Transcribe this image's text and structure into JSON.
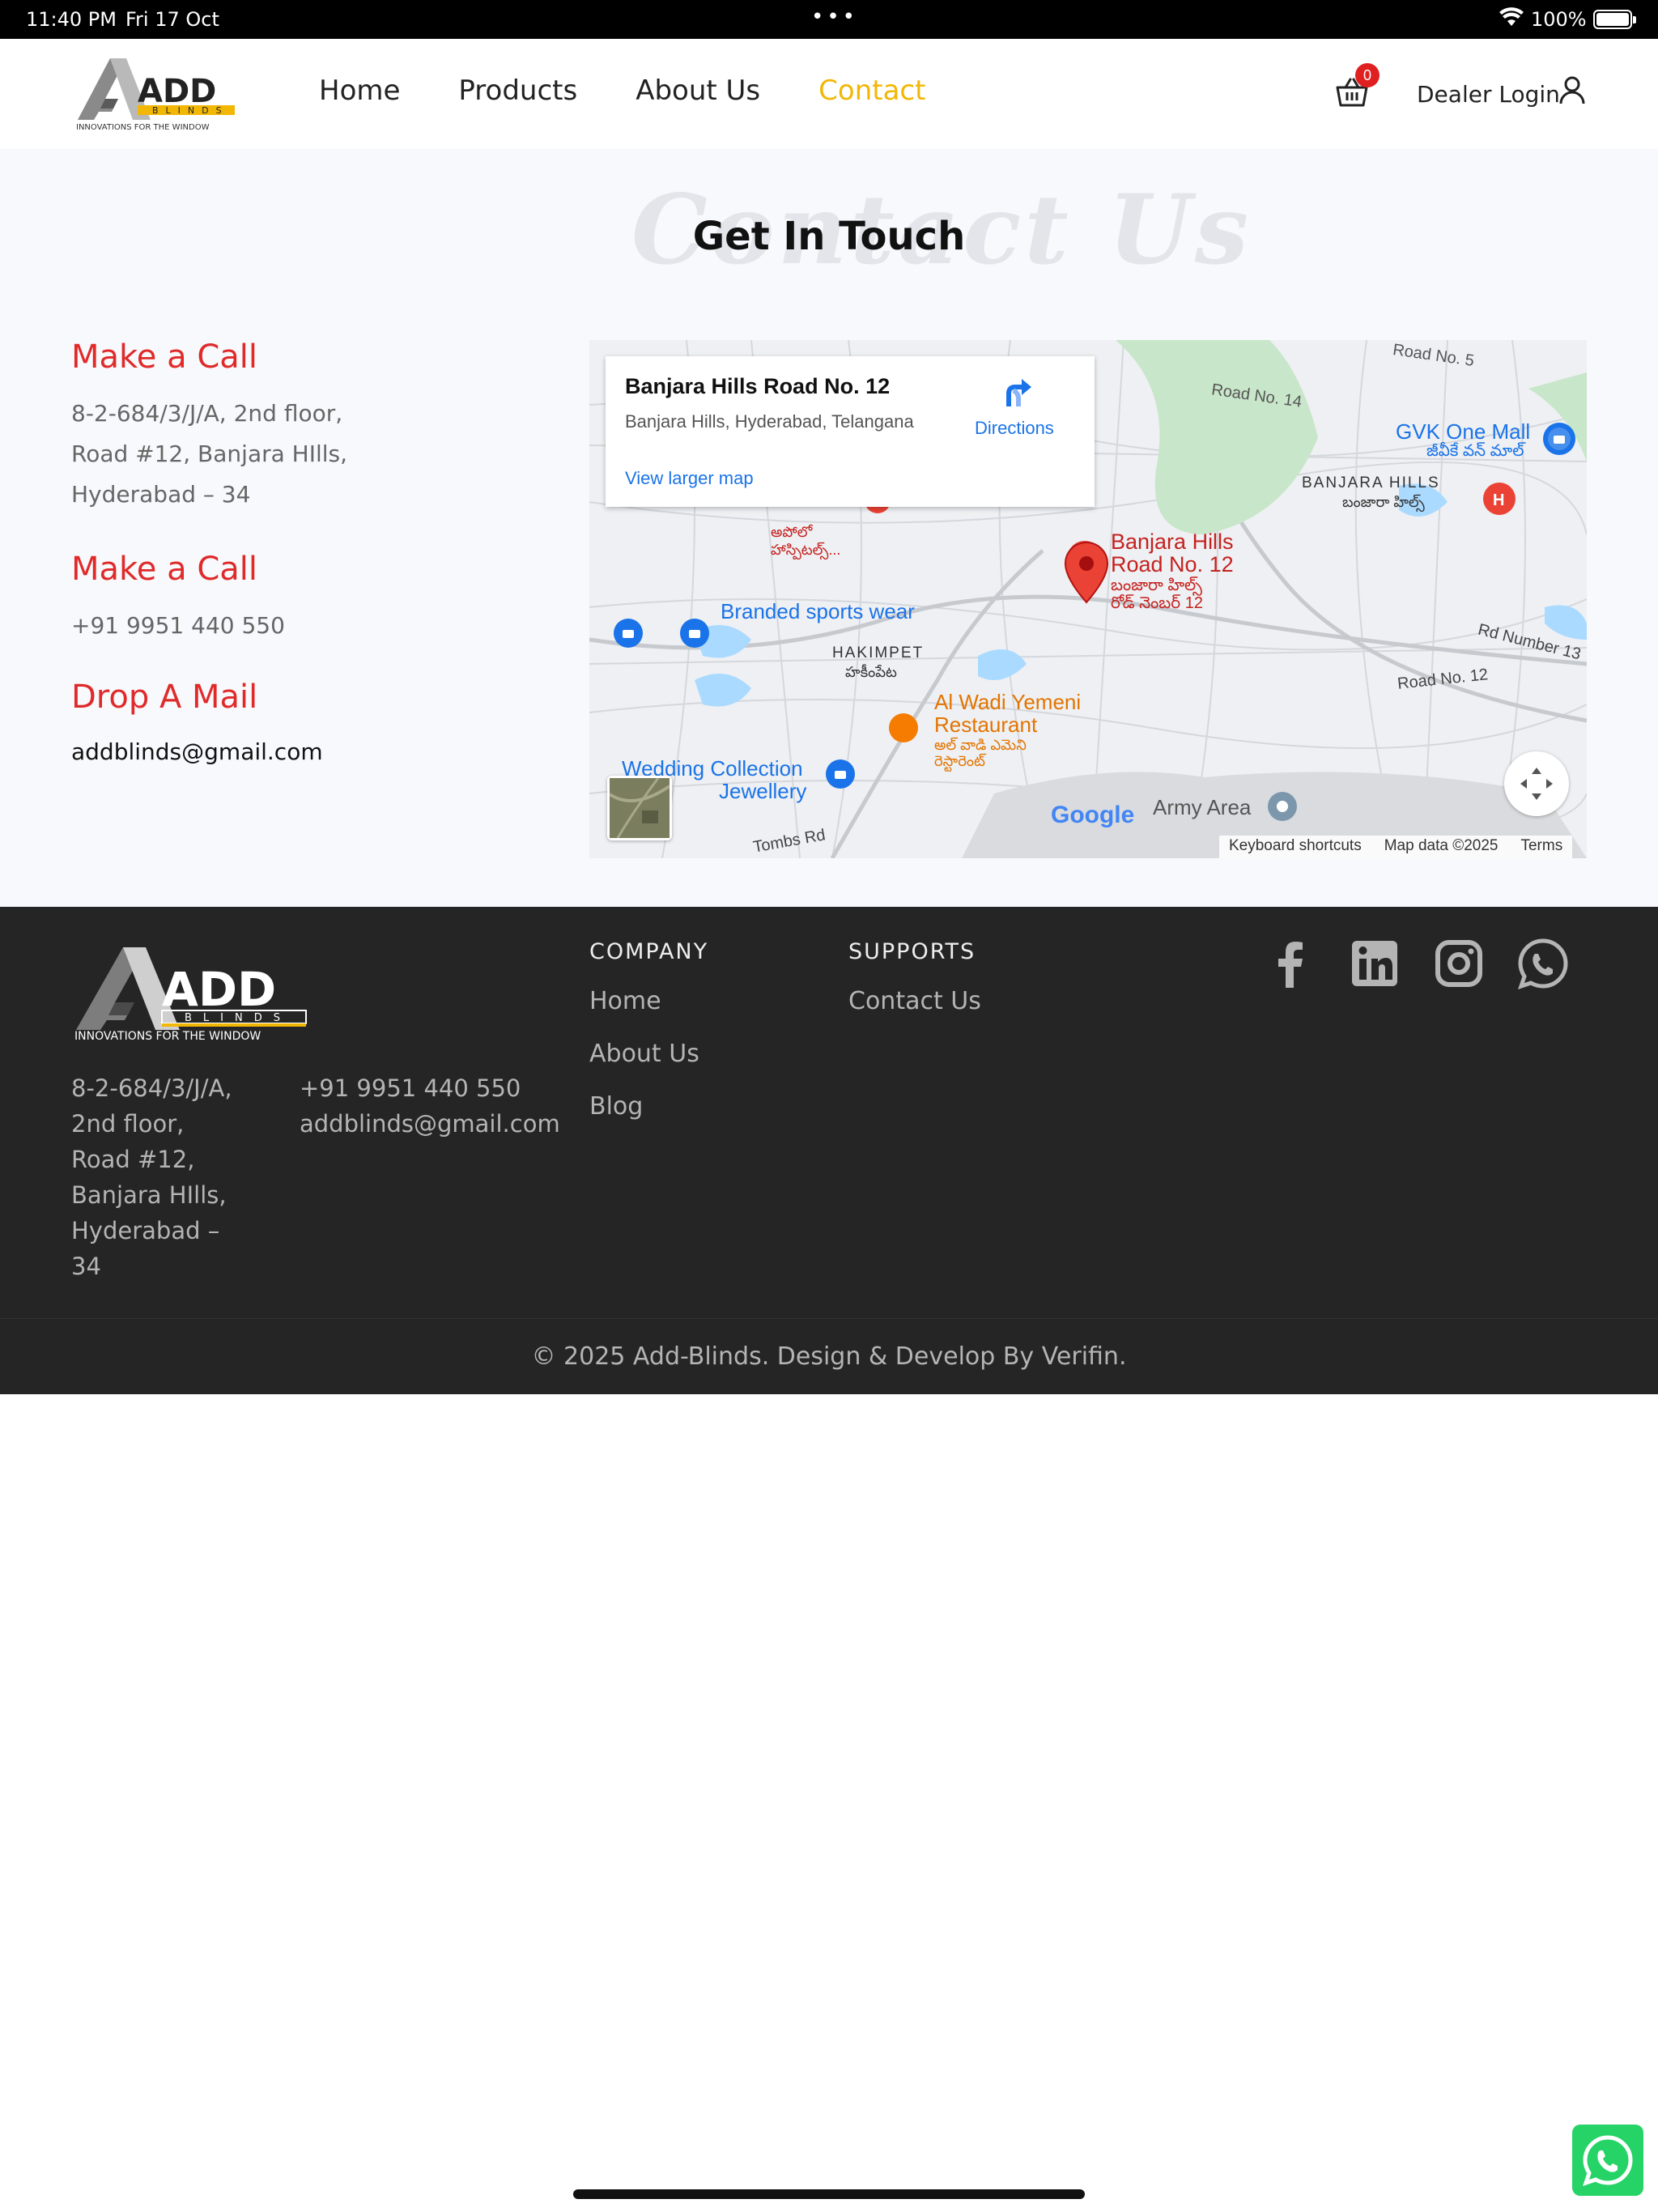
{
  "status_bar": {
    "time": "11:40 PM",
    "date": "Fri 17 Oct",
    "battery": "100%"
  },
  "header": {
    "logo_alt": "ADD BLINDS - Innovations for the window",
    "nav": [
      "Home",
      "Products",
      "About Us",
      "Contact"
    ],
    "active_nav": "Contact",
    "cart_count": "0",
    "dealer_login": "Dealer Login"
  },
  "hero": {
    "watermark": "Contact Us",
    "title": "Get In Touch"
  },
  "contact": {
    "call_heading_1": "Make a Call",
    "address_lines": [
      "8-2-684/3/J/A, 2nd floor,",
      "Road #12, Banjara HIlls,",
      "Hyderabad – 34"
    ],
    "call_heading_2": "Make a Call",
    "phone": "+91 9951 440 550",
    "mail_heading": "Drop A Mail",
    "email": "addblinds@gmail.com"
  },
  "map": {
    "place": "Banjara Hills Road No. 12",
    "place_address": "Banjara Hills, Hyderabad, Telangana",
    "directions": "Directions",
    "view_larger": "View larger map",
    "labels": {
      "road5": "Road No. 5",
      "road14": "Road No. 14",
      "gvk": "GVK One Mall",
      "gvk_te": "జీవీకే వన్ మాల్",
      "banjara": "BANJARA HILLS",
      "banjara_te": "బంజారా హిల్స్",
      "pin_name_1": "Banjara Hills",
      "pin_name_2": "Road No. 12",
      "pin_te_1": "బంజారా హిల్స్",
      "pin_te_2": "రోడ్ నెంబర్ 12",
      "sports": "Branded sports wear",
      "hakimpet": "HAKIMPET",
      "hakimpet_te": "హకీంపేట",
      "alwadi_1": "Al Wadi Yemeni",
      "alwadi_2": "Restaurant",
      "alwadi_te_1": "అల్ వాడి ఎమెని",
      "alwadi_te_2": "రెస్టారెంట్",
      "wedding_1": "Wedding Collection",
      "wedding_2": "Jewellery",
      "rd13": "Rd Number 13",
      "road12": "Road No. 12",
      "army": "Army Area",
      "tombs": "Tombs Rd",
      "hospital_te": "అపోలో హాస్పిటల్స్..."
    },
    "google": "Google",
    "footer_links": [
      "Keyboard shortcuts",
      "Map data ©2025",
      "Terms"
    ]
  },
  "footer": {
    "address_lines": [
      "8-2-684/3/J/A,",
      "2nd floor,",
      "Road #12,",
      "Banjara HIlls,",
      "Hyderabad –",
      "34"
    ],
    "phone": "+91 9951 440 550",
    "email": "addblinds@gmail.com",
    "company_heading": "COMPANY",
    "company_links": [
      "Home",
      "About Us",
      "Blog"
    ],
    "supports_heading": "SUPPORTS",
    "supports_links": [
      "Contact Us"
    ],
    "socials": [
      "facebook-icon",
      "linkedin-icon",
      "instagram-icon",
      "whatsapp-icon"
    ],
    "copyright": "© 2025 Add-Blinds. Design & Develop By Verifin."
  },
  "colors": {
    "accent_red": "#e02a2a",
    "active_nav": "#f2b705",
    "footer_bg": "#252525",
    "map_link": "#1a73e8"
  }
}
